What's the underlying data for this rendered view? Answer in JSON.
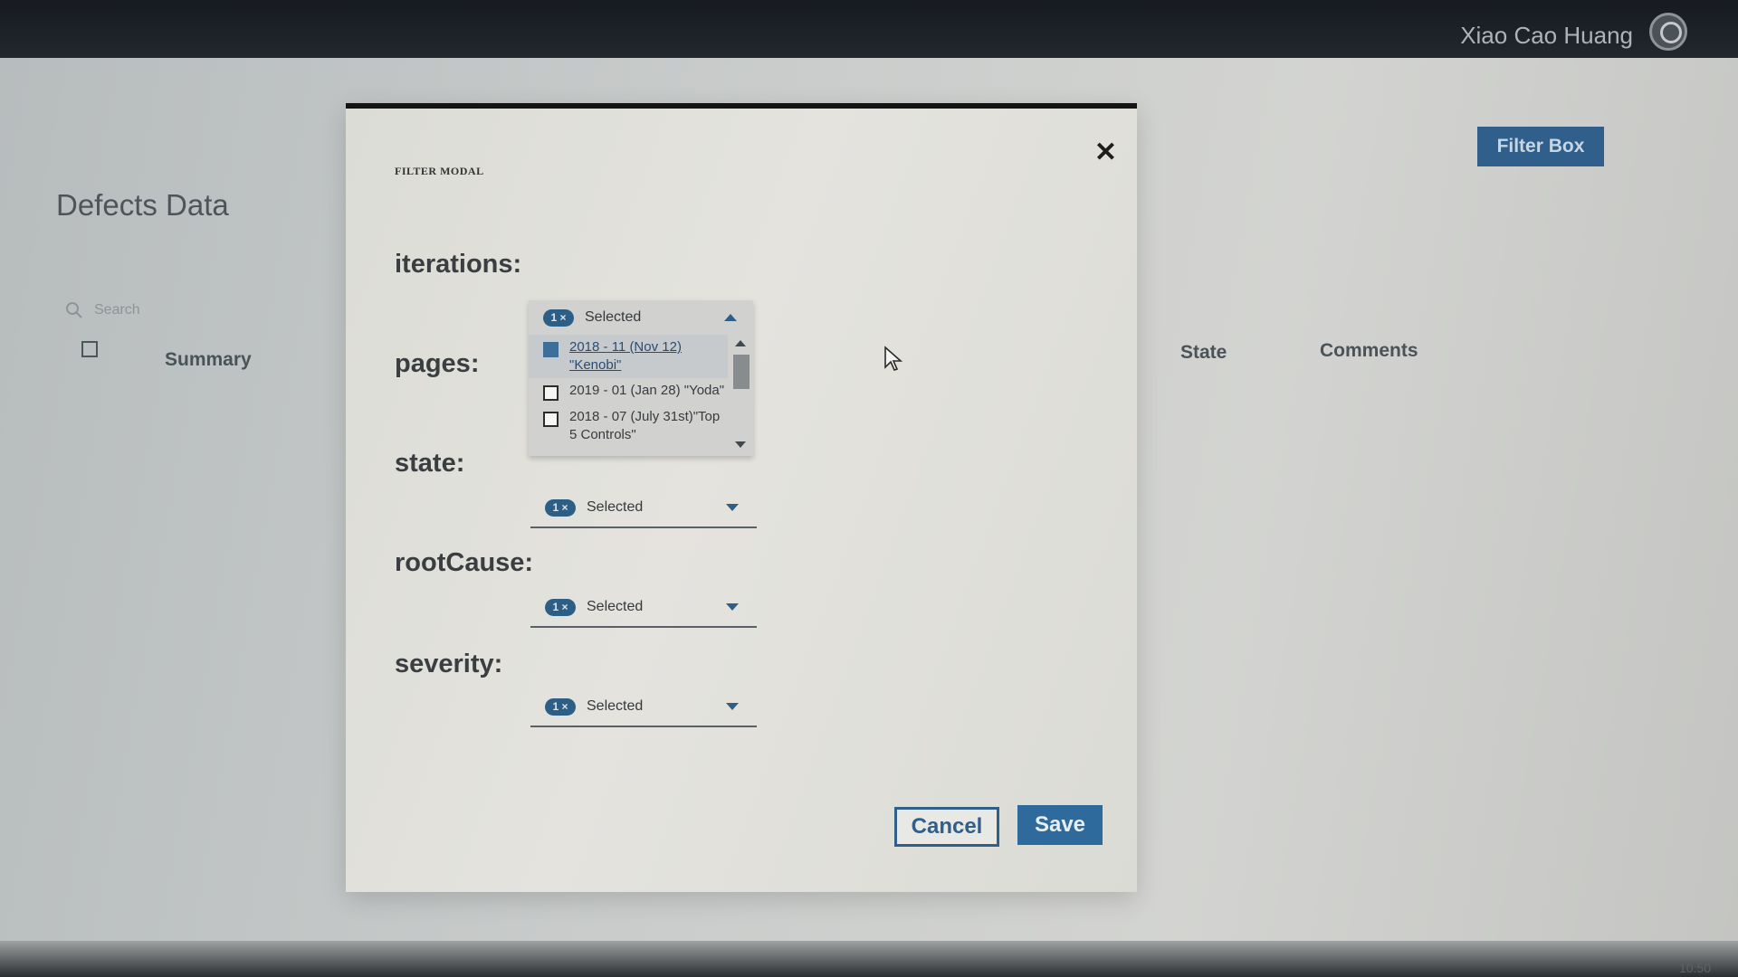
{
  "user": {
    "name": "Xiao Cao Huang"
  },
  "page": {
    "title": "Defects Data",
    "search_placeholder": "Search",
    "filter_box_label": "Filter Box",
    "table": {
      "columns": [
        "Summary",
        "State",
        "Comments"
      ]
    }
  },
  "modal": {
    "title": "FILTER MODAL",
    "close_symbol": "✕",
    "fields": [
      {
        "label": "iterations:"
      },
      {
        "label": "pages:"
      },
      {
        "label": "state:",
        "badge": "1 ×",
        "value": "Selected"
      },
      {
        "label": "rootCause:",
        "badge": "1 ×",
        "value": "Selected"
      },
      {
        "label": "severity:",
        "badge": "1 ×",
        "value": "Selected"
      }
    ],
    "iterations_dropdown": {
      "badge": "1 ×",
      "value": "Selected",
      "expanded": true,
      "options": [
        {
          "label": "2018 - 11 (Nov 12) \"Kenobi\"",
          "checked": true
        },
        {
          "label": "2019 - 01 (Jan 28) \"Yoda\"",
          "checked": false
        },
        {
          "label": "2018 - 07 (July 31st)\"Top 5 Controls\"",
          "checked": false
        }
      ]
    },
    "buttons": {
      "cancel": "Cancel",
      "save": "Save"
    }
  },
  "footer": {
    "time": "10:50"
  }
}
